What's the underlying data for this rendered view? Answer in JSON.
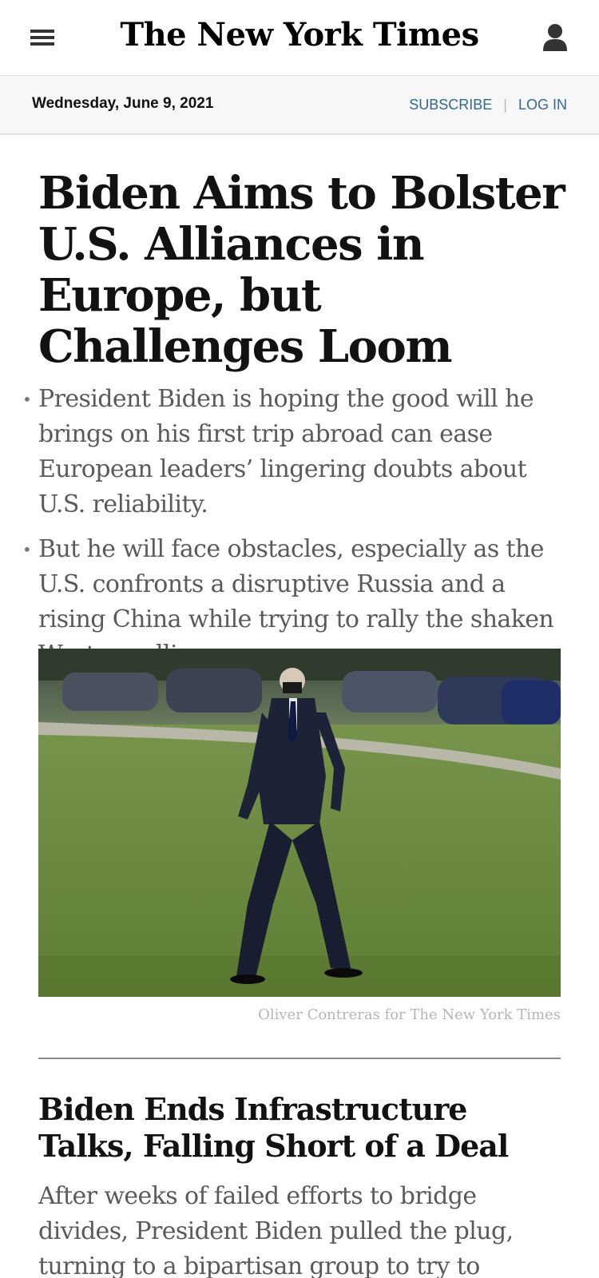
{
  "header": {
    "logo": "The New York Times",
    "menu_icon": "hamburger-menu-icon",
    "account_icon": "user-icon"
  },
  "datebar": {
    "date": "Wednesday, June 9, 2021",
    "subscribe": "SUBSCRIBE",
    "login": "LOG IN",
    "link_color": "#326891"
  },
  "lead_story": {
    "headline": "Biden Aims to Bolster U.S. Alliances in Europe, but Challenges Loom",
    "bullets": [
      "President Biden is hoping the good will he brings on his first trip abroad can ease European leaders’ lingering doubts about U.S. reliability.",
      "But he will face obstacles, especially as the U.S. confronts a disruptive Russia and a rising China while trying to rally the shaken Western alliance."
    ],
    "photo_credit": "Oliver Contreras for The New York Times"
  },
  "second_story": {
    "headline": "Biden Ends Infrastructure Talks, Falling Short of a Deal",
    "summary": "After weeks of failed efforts to bridge divides, President Biden pulled the plug, turning to a bipartisan group to try to salvage a chance at"
  }
}
